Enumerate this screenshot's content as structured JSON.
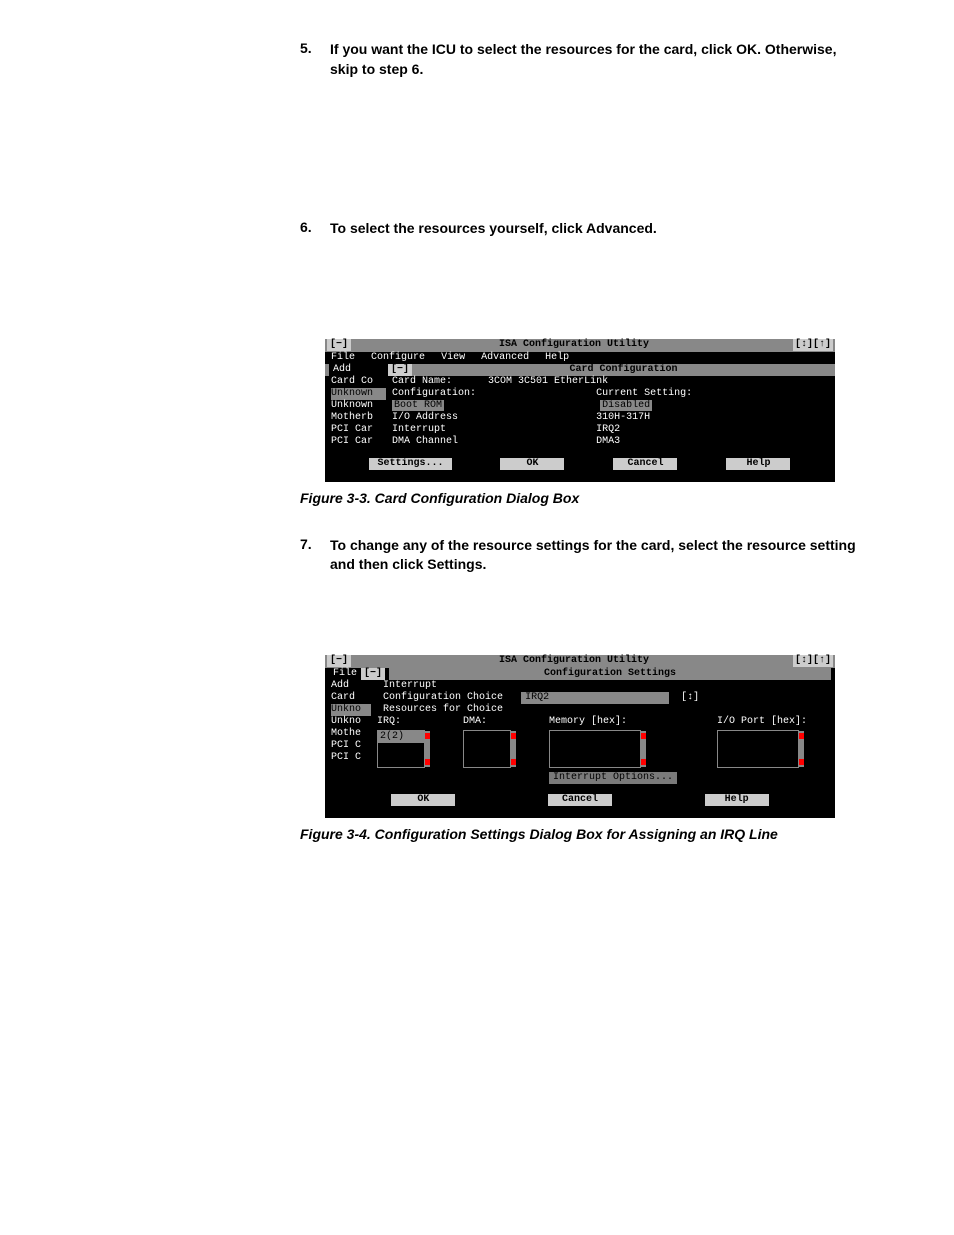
{
  "steps": {
    "s5": {
      "num": "5.",
      "text": "If you want the ICU to select the resources for the card, click OK. Otherwise, skip to step 6."
    },
    "s6": {
      "num": "6.",
      "text": "To select the resources yourself, click Advanced."
    },
    "s7": {
      "num": "7.",
      "text": "To change any of the resource settings for the card, select the resource setting and then click Settings."
    }
  },
  "fig1": {
    "caption": "Figure 3-3.  Card Configuration Dialog Box",
    "title": "ISA Configuration Utility",
    "window_ctrl_left": "[−]",
    "window_ctrl_right": "[↕][↑]",
    "menu": {
      "file": "File",
      "configure": "Configure",
      "view": "View",
      "advanced": "Advanced",
      "help": "Help"
    },
    "sub_left": "Add",
    "sub_left_box": "[−]",
    "sub_title": "Card Configuration",
    "side": [
      "Card Co",
      "Unknown",
      "Unknown",
      "Motherb",
      "PCI Car",
      "PCI Car"
    ],
    "rows": {
      "r1a": "Card Name:",
      "r1b": "3COM 3C501 EtherLink",
      "r2a": "Configuration:",
      "r2b": "Current Setting:",
      "r3a": "Boot ROM",
      "r3b": "Disabled",
      "r4a": "I/O Address",
      "r4b": "310H-317H",
      "r5a": "Interrupt",
      "r5b": "IRQ2",
      "r6a": "DMA Channel",
      "r6b": "DMA3"
    },
    "buttons": {
      "settings": "Settings...",
      "ok": "OK",
      "cancel": "Cancel",
      "help": "Help"
    }
  },
  "fig2": {
    "caption": "Figure 3-4.  Configuration Settings Dialog Box for Assigning an IRQ Line",
    "title": "ISA Configuration Utility",
    "window_ctrl_left": "[−]",
    "window_ctrl_right": "[↕][↑]",
    "menu_file": "File",
    "menu_box": "[−]",
    "sub_title": "Configuration Settings",
    "side": [
      "Add",
      "Card",
      "Unkno",
      "Unkno",
      "Mothe",
      "PCI C",
      "PCI C"
    ],
    "line1": "Interrupt",
    "line2a": "Configuration Choice",
    "line2b": "IRQ2",
    "line2c": "[↕]",
    "line3": "Resources for Choice",
    "col_irq": "IRQ:",
    "col_dma": "DMA:",
    "col_mem": "Memory [hex]:",
    "col_io": "I/O Port [hex]:",
    "irq_value": "2(2)",
    "extra_btn": "Interrupt Options...",
    "buttons": {
      "ok": "OK",
      "cancel": "Cancel",
      "help": "Help"
    }
  }
}
